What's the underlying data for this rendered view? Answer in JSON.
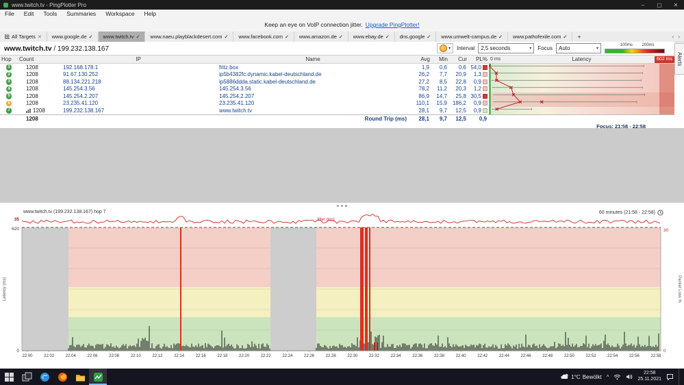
{
  "window": {
    "title": "www.twitch.tv - PingPlotter Pro",
    "minimize": "–",
    "maximize": "▢",
    "close": "✕"
  },
  "menu": {
    "items": [
      "File",
      "Edit",
      "Tools",
      "Summaries",
      "Workspace",
      "Help"
    ]
  },
  "notice": {
    "text": "Keep an eye on VoIP connection jitter.",
    "link": "Upgrade PingPlotter!"
  },
  "tabs": {
    "all_label": "All Targets",
    "close_glyph": "✕",
    "check_glyph": "✓",
    "new_tab": "+",
    "scroll_left": "‹",
    "scroll_right": "›",
    "items": [
      {
        "label": "www.google.de",
        "checked": true,
        "active": false
      },
      {
        "label": "www.twitch.tv",
        "checked": true,
        "active": true
      },
      {
        "label": "www.naeu.playblackdesert.com",
        "checked": true,
        "active": false
      },
      {
        "label": "www.facebook.com",
        "checked": true,
        "active": false
      },
      {
        "label": "www.amazon.de",
        "checked": true,
        "active": false
      },
      {
        "label": "www.ebay.de",
        "checked": true,
        "active": false
      },
      {
        "label": "dns.google",
        "checked": true,
        "active": false
      },
      {
        "label": "www.umwelt-campus.de",
        "checked": true,
        "active": false
      },
      {
        "label": "www.pathofexile.com",
        "checked": true,
        "active": false
      }
    ]
  },
  "target": {
    "name": "www.twitch.tv",
    "separator": " / ",
    "ip": "199.232.138.167",
    "interval_label": "Interval",
    "interval_value": "2,5 seconds",
    "focus_label": "Focus",
    "focus_value": "Auto",
    "legend_low": "100ms",
    "legend_high": "200ms",
    "alerts_label": "Alerts"
  },
  "table": {
    "headers": {
      "hop": "Hop",
      "count": "Count",
      "ip": "IP",
      "name": "Name",
      "avg": "Avg",
      "min": "Min",
      "cur": "Cur",
      "pl": "PL%",
      "latency": "Latency",
      "lat_zero": "0 ms",
      "lat_max": "602 ms"
    },
    "rows": [
      {
        "hop": "1",
        "count": "1208",
        "ip": "192.168.178.1",
        "name": "fritz.box",
        "avg": "1,9",
        "min": "0,6",
        "cur": "0,6",
        "pl": "54,0",
        "circle": "#43a047",
        "pl_box": "#d6392e",
        "band": "norm",
        "graphed": false,
        "avg_ms": 1.9,
        "min_ms": 0.6,
        "max_ms": 545
      },
      {
        "hop": "2",
        "count": "1208",
        "ip": "91.67.130.252",
        "name": "ip5b4382fc.dynamic.kabel-deutschland.de",
        "avg": "26,2",
        "min": "7,7",
        "cur": "20,9",
        "pl": "1,3",
        "circle": "#43a047",
        "pl_box": "#f0c2b8",
        "band": "norm",
        "graphed": false,
        "avg_ms": 26.2,
        "min_ms": 7.7,
        "max_ms": 540
      },
      {
        "hop": "3",
        "count": "1208",
        "ip": "88.134.221.218",
        "name": "ip5886ddda.static.kabel-deutschland.de",
        "avg": "27,2",
        "min": "8,5",
        "cur": "22,8",
        "pl": "0,9",
        "circle": "#43a047",
        "pl_box": "#f0c2b8",
        "band": "norm",
        "graphed": false,
        "avg_ms": 27.2,
        "min_ms": 8.5,
        "max_ms": 535
      },
      {
        "hop": "4",
        "count": "1208",
        "ip": "145.254.3.56",
        "name": "145.254.3.56",
        "avg": "78,2",
        "min": "11,2",
        "cur": "20,3",
        "pl": "1,2",
        "circle": "#43a047",
        "pl_box": "#f0c2b8",
        "band": "norm",
        "graphed": false,
        "avg_ms": 78.2,
        "min_ms": 11.2,
        "max_ms": 540
      },
      {
        "hop": "5",
        "count": "1208",
        "ip": "145.254.2.207",
        "name": "145.254.2.207",
        "avg": "86,9",
        "min": "14,7",
        "cur": "25,8",
        "pl": "30,5",
        "circle": "#43a047",
        "pl_box": "#d6392e",
        "band": "hot",
        "graphed": false,
        "avg_ms": 86.9,
        "min_ms": 14.7,
        "max_ms": 548
      },
      {
        "hop": "6",
        "count": "1208",
        "ip": "23.235.41.120",
        "name": "23.235.41.120",
        "avg": "110,1",
        "min": "15,9",
        "cur": "186,2",
        "pl": "0,9",
        "circle": "#f2a233",
        "pl_box": "#f0c2b8",
        "band": "hot",
        "graphed": false,
        "avg_ms": 110.1,
        "min_ms": 15.9,
        "max_ms": 520,
        "cur_ms": 186.2
      },
      {
        "hop": "7",
        "count": "1208",
        "ip": "199.232.138.167",
        "name": "www.twitch.tv",
        "avg": "28,1",
        "min": "9,7",
        "cur": "12,5",
        "pl": "0,9",
        "circle": "#43a047",
        "pl_box": "#cfe5c4",
        "band": "norm",
        "graphed": true,
        "avg_ms": 28.1,
        "min_ms": 9.7,
        "max_ms": 150
      }
    ],
    "roundtrip": {
      "count": "1208",
      "label": "Round Trip (ms)",
      "avg": "28,1",
      "min": "9,7",
      "cur": "12,5",
      "pl": "0,9"
    },
    "focus_note": "Focus: 21:58 - 22:58"
  },
  "timeline": {
    "title": "www.twitch.tv (199.232.138.167) hop 7",
    "range_label": "60 minutes (21:58 - 22:58)",
    "jitter_label": "Jitter (ms)",
    "jitter_max": "35",
    "lat_max": "620",
    "lat_min": "0",
    "left_axis": "Latency (ms)",
    "right_axis": "Packet Loss %",
    "right_top": "30",
    "right_bottom": "0",
    "colors": {
      "red": "#f3cfc8",
      "yellow": "#f5f0c0",
      "green": "#cbe4bd",
      "gray": "#cdcdcd",
      "loss": "#dd2f22",
      "jitter": "#c22b22"
    },
    "gray_bands": [
      [
        32,
        100
      ],
      [
        395,
        462
      ]
    ],
    "data_regions": [
      [
        100,
        395
      ],
      [
        462,
        963
      ]
    ],
    "loss_spikes": [
      [
        263,
        2
      ],
      [
        526,
        5
      ],
      [
        533,
        4
      ],
      [
        539,
        2
      ]
    ],
    "loss_ticks": [
      546,
      550
    ],
    "x_ticks": [
      "22:00",
      "22:02",
      "22:04",
      "22:06",
      "22:08",
      "22:10",
      "22:12",
      "22:14",
      "22:16",
      "22:18",
      "22:20",
      "22:22",
      "22:24",
      "22:26",
      "22:28",
      "22:30",
      "22:32",
      "22:34",
      "22:36",
      "22:38",
      "22:40",
      "22:42",
      "22:44",
      "22:46",
      "22:48",
      "22:50",
      "22:52",
      "22:54",
      "22:56",
      "22:58"
    ]
  },
  "taskbar": {
    "apps": [
      "start",
      "task-view",
      "edge",
      "firefox",
      "explorer",
      "pingplotter"
    ],
    "active_app": "pingplotter",
    "weather_temp": "1°C",
    "weather_desc": "Bewölkt",
    "time": "22:58",
    "date": "25.11.2021"
  }
}
